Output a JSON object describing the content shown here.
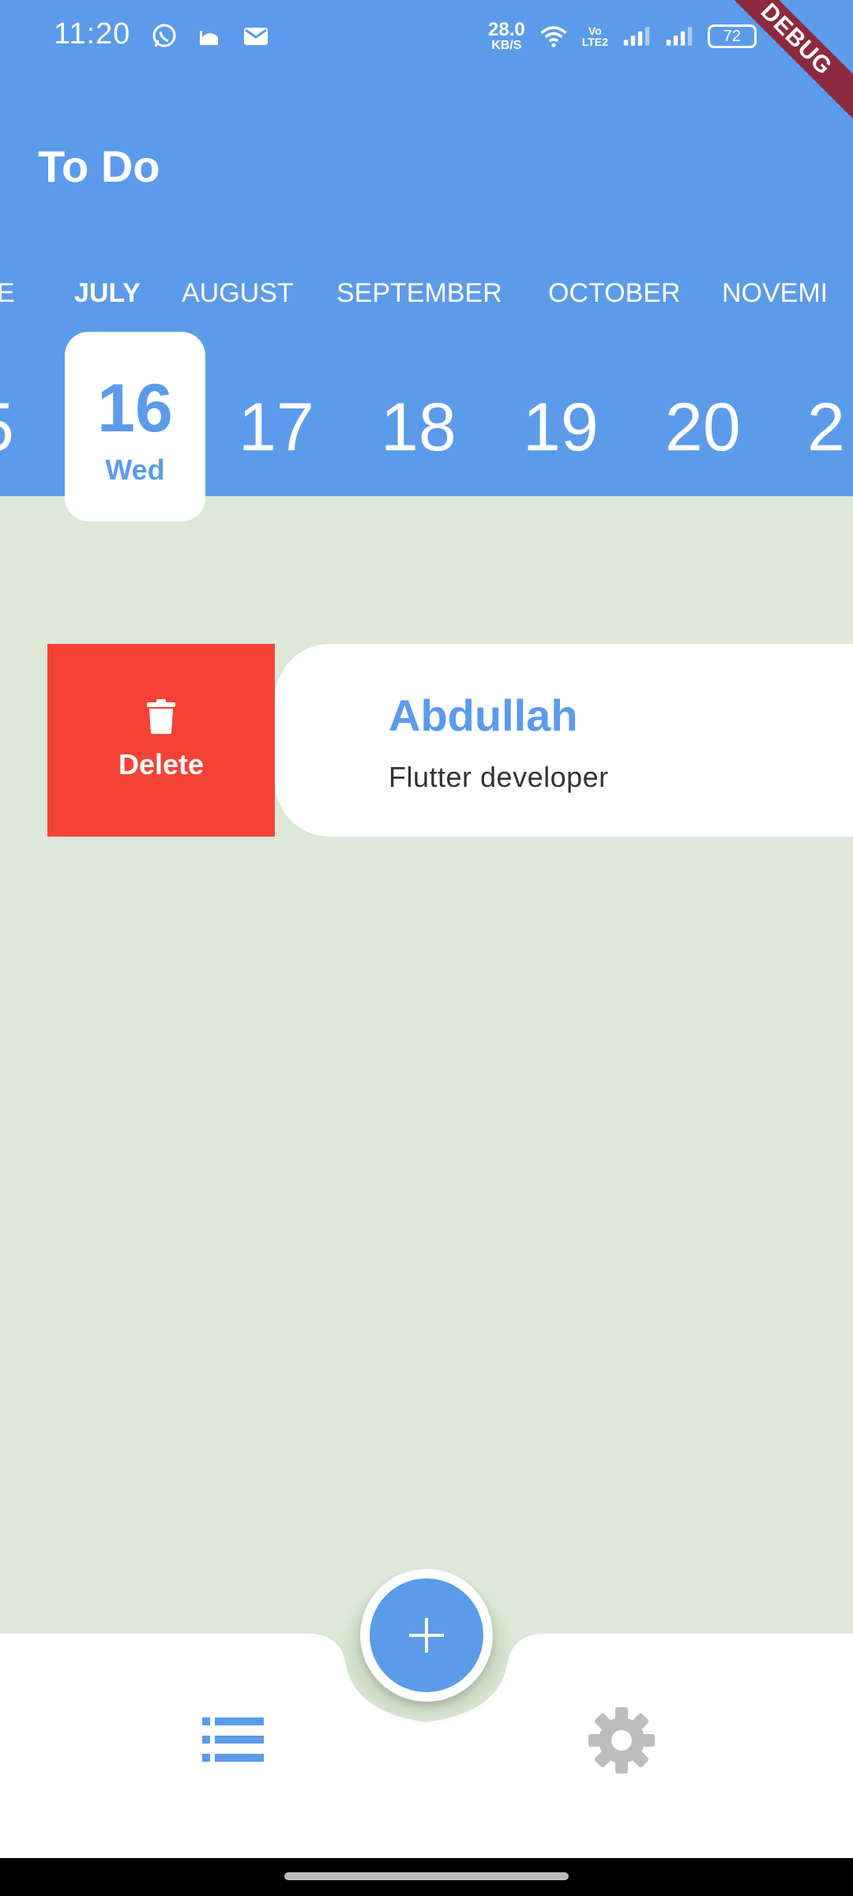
{
  "status_bar": {
    "time": "11:20",
    "net_speed_value": "28.0",
    "net_speed_unit": "KB/S",
    "volte_top": "Vo",
    "volte_bottom": "LTE2",
    "battery": "72",
    "icons": [
      "whatsapp-icon",
      "mosque-icon",
      "mail-icon",
      "wifi-icon",
      "signal-icon",
      "signal-icon",
      "battery-icon"
    ]
  },
  "debug_banner": "DEBUG",
  "app_bar": {
    "title": "To Do"
  },
  "calendar": {
    "months": [
      "E",
      "JULY",
      "AUGUST",
      "SEPTEMBER",
      "OCTOBER",
      "NOVEMI"
    ],
    "selected_month": "JULY",
    "days": [
      "5",
      "17",
      "18",
      "19",
      "20",
      "2"
    ],
    "selected_day": {
      "number": "16",
      "weekday": "Wed"
    }
  },
  "task": {
    "title": "Abdullah",
    "description": "Flutter developer",
    "swipe_action": {
      "label": "Delete",
      "icon": "trash-icon",
      "color": "#f44336"
    }
  },
  "bottom_nav": {
    "items": [
      {
        "icon": "list-icon",
        "active": true
      },
      {
        "icon": "gear-icon",
        "active": false
      }
    ],
    "fab_icon": "plus-icon"
  },
  "colors": {
    "primary": "#5c9bea",
    "background": "#dde8d9",
    "delete": "#f44336",
    "debug": "#8e2a3f"
  }
}
